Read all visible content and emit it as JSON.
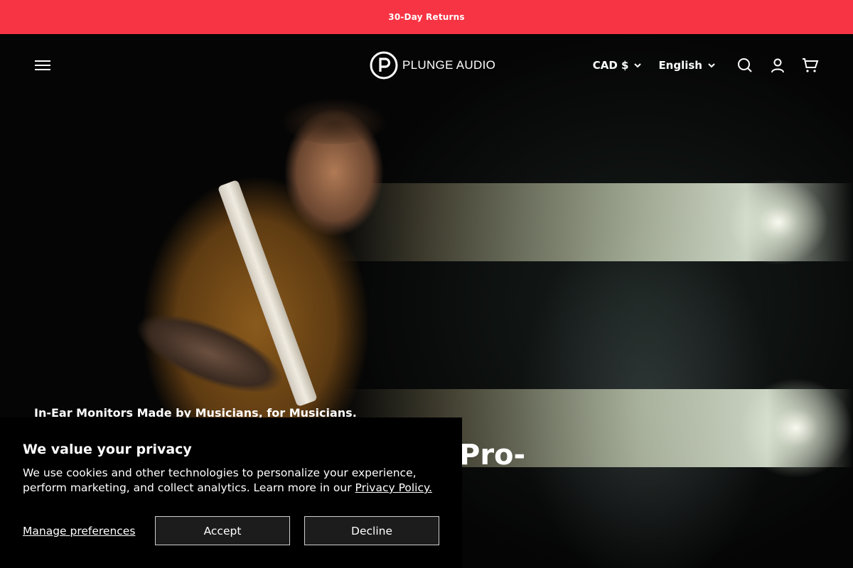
{
  "announcement": {
    "text": "30-Day Returns"
  },
  "header": {
    "logo_text": "PLUNGE AUDIO",
    "currency": "CAD $",
    "language": "English",
    "icons": [
      "menu-icon",
      "search-icon",
      "account-icon",
      "cart-icon"
    ]
  },
  "hero": {
    "subtitle": "In-Ear Monitors Made by Musicians, for Musicians.",
    "title_visible": "Pro-"
  },
  "cookie_banner": {
    "title": "We value your privacy",
    "text": "We use cookies and other technologies to personalize your experience, perform marketing, and collect analytics. Learn more in our",
    "link": "Privacy Policy.",
    "manage": "Manage preferences",
    "accept": "Accept",
    "decline": "Decline"
  },
  "colors": {
    "announcement_bg": "#f73444",
    "background": "#000000",
    "text": "#ffffff"
  }
}
